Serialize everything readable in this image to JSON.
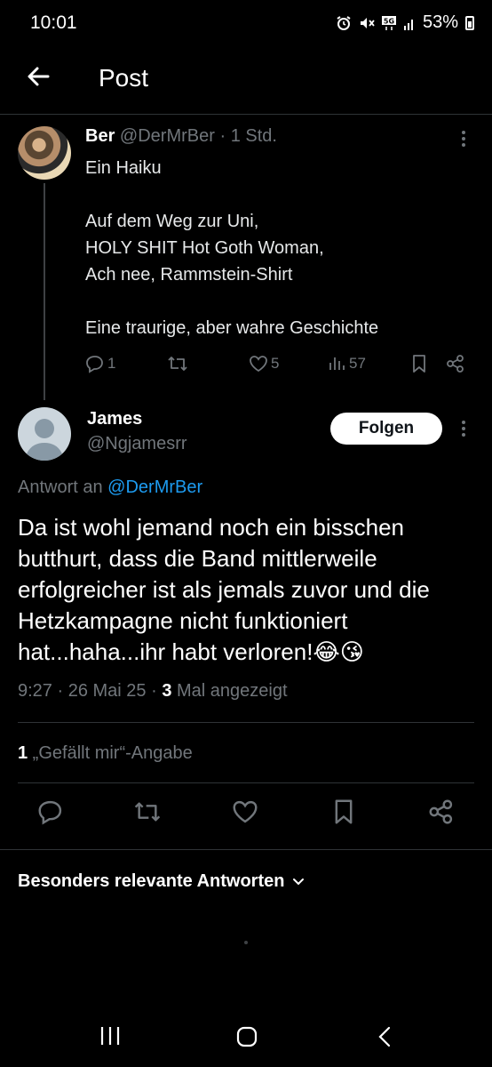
{
  "status": {
    "time": "10:01",
    "battery": "53%"
  },
  "header": {
    "title": "Post"
  },
  "parent_post": {
    "name": "Ber",
    "handle": "@DerMrBer",
    "separator": " · ",
    "time": "1 Std.",
    "text": "Ein Haiku\n\nAuf dem Weg zur Uni,\nHOLY SHIT Hot Goth Woman,\nAch nee, Rammstein-Shirt\n\nEine traurige, aber wahre Geschichte",
    "replies": "1",
    "likes": "5",
    "views": "57"
  },
  "main_post": {
    "name": "James",
    "handle": "@Ngjamesrr",
    "follow_label": "Folgen",
    "reply_to_prefix": "Antwort an ",
    "reply_to_handle": "@DerMrBer",
    "text": "Da ist wohl jemand noch ein bisschen butthurt, dass die Band mittlerweile erfolgreicher ist als jemals zuvor und die Hetzkampagne nicht funktioniert hat...haha...ihr habt verloren!😂😘",
    "timestamp": "9:27 · 26 Mai 25 · ",
    "views_count": "3",
    "views_label": " Mal angezeigt",
    "likes_count": "1",
    "likes_label": " „Gefällt mir“-Angabe"
  },
  "replies_section": {
    "sort_label": "Besonders relevante Antworten"
  },
  "colors": {
    "background": "#000000",
    "text": "#e7e9ea",
    "muted": "#71767b",
    "accent": "#1d9bf0",
    "divider": "#2f3336"
  },
  "icons": [
    "back-arrow-icon",
    "more-icon",
    "reply-icon",
    "retweet-icon",
    "heart-icon",
    "views-icon",
    "bookmark-icon",
    "share-icon",
    "chevron-down-icon"
  ]
}
